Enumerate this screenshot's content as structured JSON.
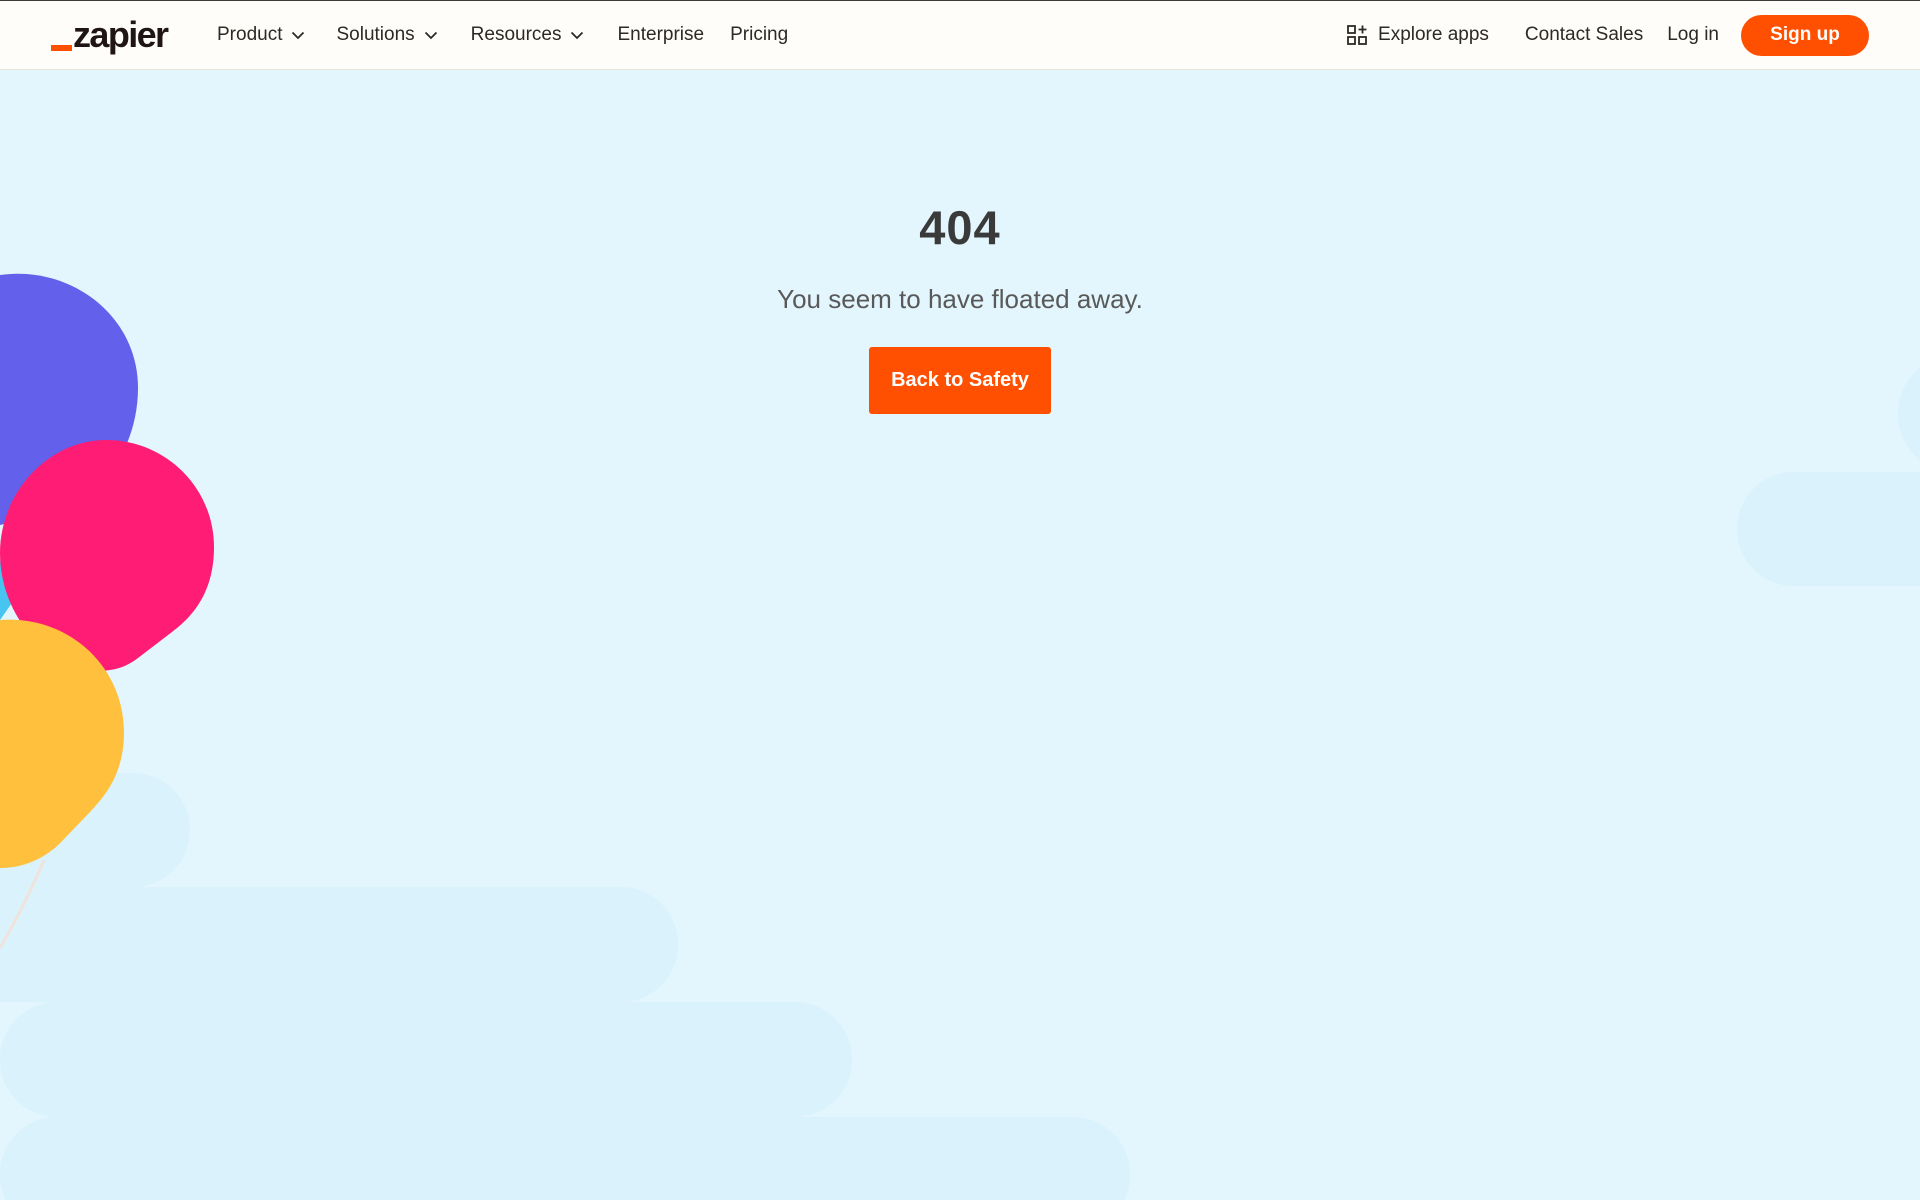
{
  "header": {
    "logo": "zapier",
    "nav": [
      {
        "label": "Product",
        "has_dropdown": true
      },
      {
        "label": "Solutions",
        "has_dropdown": true
      },
      {
        "label": "Resources",
        "has_dropdown": true
      },
      {
        "label": "Enterprise",
        "has_dropdown": false
      },
      {
        "label": "Pricing",
        "has_dropdown": false
      }
    ],
    "explore_apps": "Explore apps",
    "contact_sales": "Contact Sales",
    "log_in": "Log in",
    "sign_up": "Sign up"
  },
  "error": {
    "code": "404",
    "message": "You seem to have floated away.",
    "button": "Back to Safety"
  },
  "colors": {
    "brand_orange": "#ff4f00",
    "background": "#e3f5fd",
    "header_bg": "#fffdf9",
    "balloon_purple": "#6360ec",
    "balloon_pink": "#ff1c75",
    "balloon_yellow": "#ffc13d",
    "balloon_cyan": "#47c4f0",
    "cloud": "#d9f2fb"
  },
  "icons": {
    "chevron": "chevron-down-icon",
    "explore": "apps-grid-icon"
  }
}
